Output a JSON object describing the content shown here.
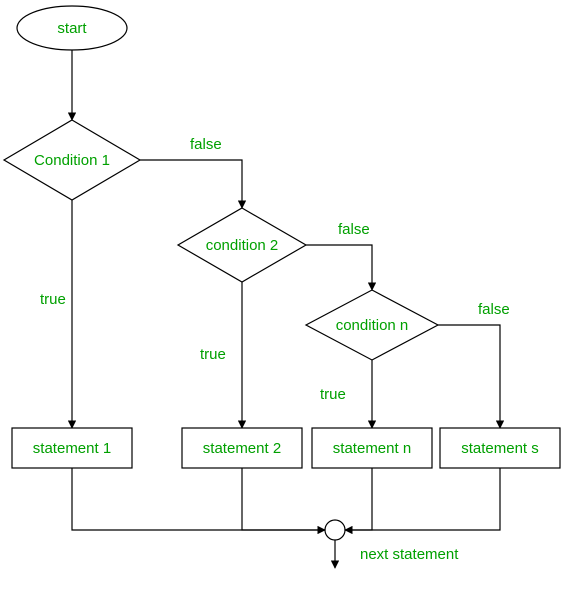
{
  "flowchart": {
    "start": "start",
    "cond1": "Condition 1",
    "cond2": "condition 2",
    "cond3": "condition n",
    "stmt1": "statement 1",
    "stmt2": "statement 2",
    "stmt3": "statement n",
    "stmt4": "statement s",
    "next": "next statement",
    "label_true": "true",
    "label_false": "false"
  }
}
